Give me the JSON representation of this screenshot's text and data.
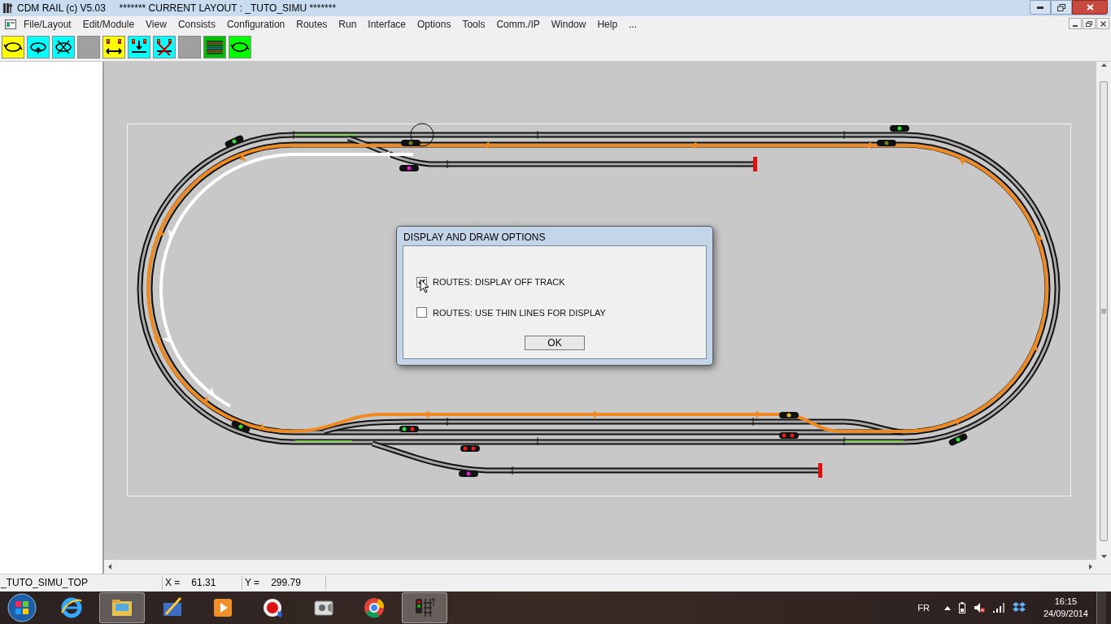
{
  "window": {
    "title": "CDM RAIL (c) V5.03     ******* CURRENT LAYOUT : _TUTO_SIMU *******"
  },
  "menu": [
    "File/Layout",
    "Edit/Module",
    "View",
    "Consists",
    "Configuration",
    "Routes",
    "Run",
    "Interface",
    "Options",
    "Tools",
    "Comm./IP",
    "Window",
    "Help",
    "..."
  ],
  "toolbar": [
    {
      "kind": "loop",
      "color": "#ffff00"
    },
    {
      "kind": "loop-arrow",
      "color": "#00ffff"
    },
    {
      "kind": "loop-cross",
      "color": "#00ffff"
    },
    {
      "kind": "blank",
      "color": "#a0a0a0"
    },
    {
      "kind": "signals-arrow",
      "color": "#ffff00"
    },
    {
      "kind": "signals-down",
      "color": "#00ffff"
    },
    {
      "kind": "signals-cross",
      "color": "#00ffff"
    },
    {
      "kind": "blank",
      "color": "#a0a0a0"
    },
    {
      "kind": "lines",
      "color": "#00c000"
    },
    {
      "kind": "loop",
      "color": "#00ff00"
    }
  ],
  "dialog": {
    "title": "DISPLAY AND DRAW OPTIONS",
    "options": [
      {
        "label": "ROUTES: DISPLAY OFF TRACK",
        "checked": true
      },
      {
        "label": "ROUTES: USE THIN LINES FOR DISPLAY",
        "checked": false
      }
    ],
    "button": "OK"
  },
  "status_bar": {
    "layout": "_TUTO_SIMU_TOP",
    "x_label": "X =",
    "x_value": "61.31",
    "y_label": "Y =",
    "y_value": "299.79"
  },
  "taskbar": {
    "language": "FR",
    "time": "16:15",
    "date": "24/09/2014"
  }
}
